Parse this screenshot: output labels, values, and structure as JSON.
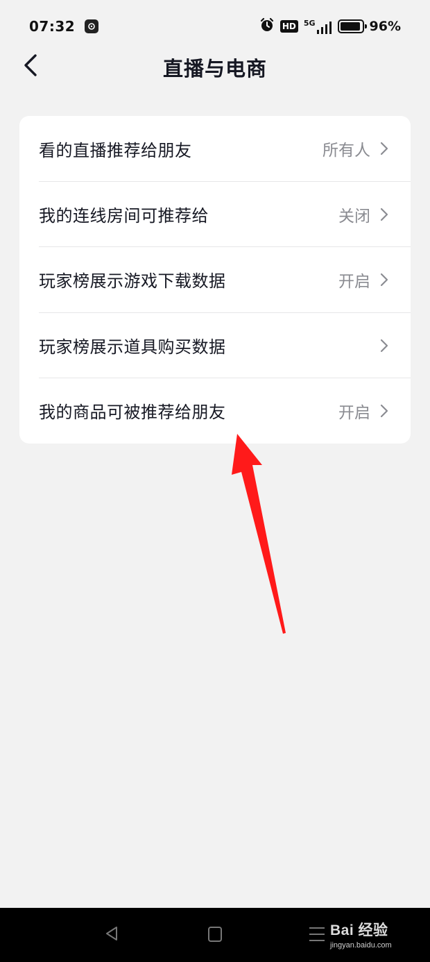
{
  "status_bar": {
    "time": "07:32",
    "app_icon": "shield-app-icon",
    "alarm_icon": "alarm-icon",
    "hd_label": "HD",
    "network_label": "5G",
    "battery_percent": "96%",
    "battery_level": 0.96
  },
  "header": {
    "back_icon": "chevron-left-icon",
    "title": "直播与电商"
  },
  "settings": {
    "items": [
      {
        "label": "看的直播推荐给朋友",
        "value": "所有人"
      },
      {
        "label": "我的连线房间可推荐给",
        "value": "关闭"
      },
      {
        "label": "玩家榜展示游戏下载数据",
        "value": "开启"
      },
      {
        "label": "玩家榜展示道具购买数据",
        "value": ""
      },
      {
        "label": "我的商品可被推荐给朋友",
        "value": "开启"
      }
    ],
    "chevron_icon": "chevron-right-icon"
  },
  "annotation": {
    "arrow_color": "#ff1a1a"
  },
  "system_nav": {
    "back_icon": "triangle-back-icon",
    "home_icon": "square-home-icon",
    "menu_icon": "menu-lines-icon"
  },
  "watermark": {
    "brand": "Bai 经验",
    "url": "jingyan.baidu.com"
  }
}
